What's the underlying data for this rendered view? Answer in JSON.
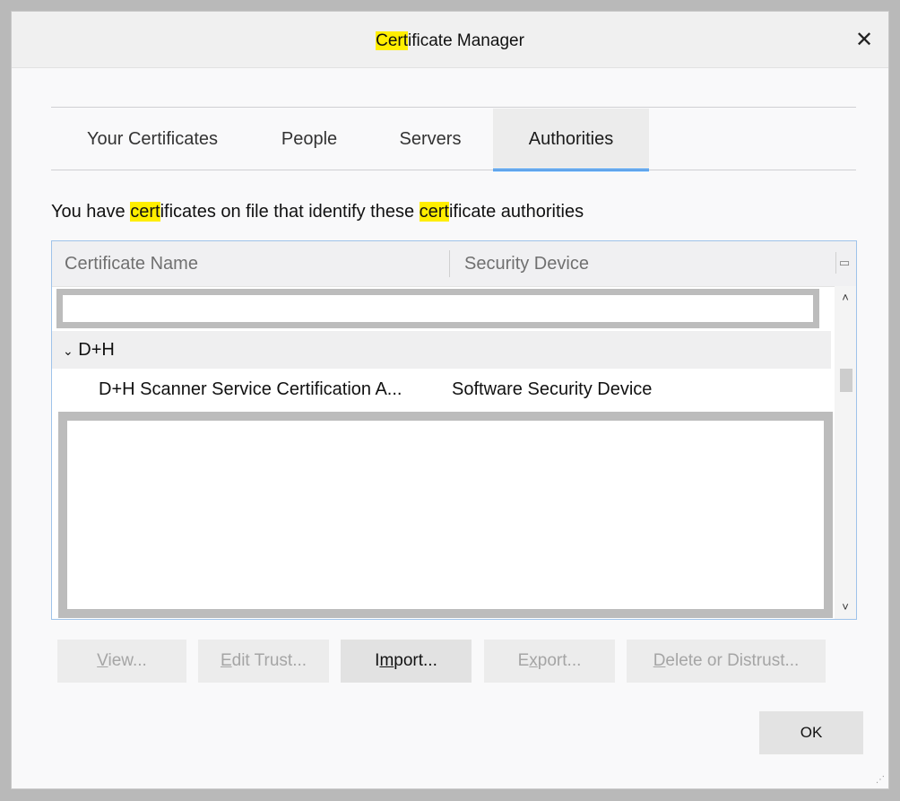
{
  "window": {
    "title_highlight": "Cert",
    "title_rest": "ificate Manager",
    "close_glyph": "✕"
  },
  "tabs": [
    {
      "label": "Your Certificates",
      "active": false
    },
    {
      "label": "People",
      "active": false
    },
    {
      "label": "Servers",
      "active": false
    },
    {
      "label": "Authorities",
      "active": true
    }
  ],
  "description": {
    "part1": "You have ",
    "hl1": "cert",
    "part2": "ificates on file that identify these ",
    "hl2": "cert",
    "part3": "ificate authorities"
  },
  "tree": {
    "columns": [
      "Certificate Name",
      "Security Device"
    ],
    "column_picker_icon": "column-picker-icon",
    "groups": [
      {
        "name": "D+H",
        "expanded": true,
        "rows": [
          {
            "name": "D+H Scanner Service Certification A...",
            "device": "Software Security Device"
          }
        ]
      }
    ]
  },
  "buttons": {
    "view": {
      "pre": "",
      "key": "V",
      "post": "iew...",
      "enabled": false
    },
    "edit_trust": {
      "pre": "",
      "key": "E",
      "post": "dit Trust...",
      "enabled": false
    },
    "import": {
      "pre": "I",
      "key": "m",
      "post": "port...",
      "enabled": true
    },
    "export": {
      "pre": "E",
      "key": "x",
      "post": "port...",
      "enabled": false
    },
    "delete": {
      "pre": "",
      "key": "D",
      "post": "elete or Distrust...",
      "enabled": false
    },
    "ok": "OK"
  },
  "colors": {
    "highlight": "#ffee00",
    "active_tab_underline": "#0a84ff",
    "tree_border": "#9fc3ea"
  }
}
